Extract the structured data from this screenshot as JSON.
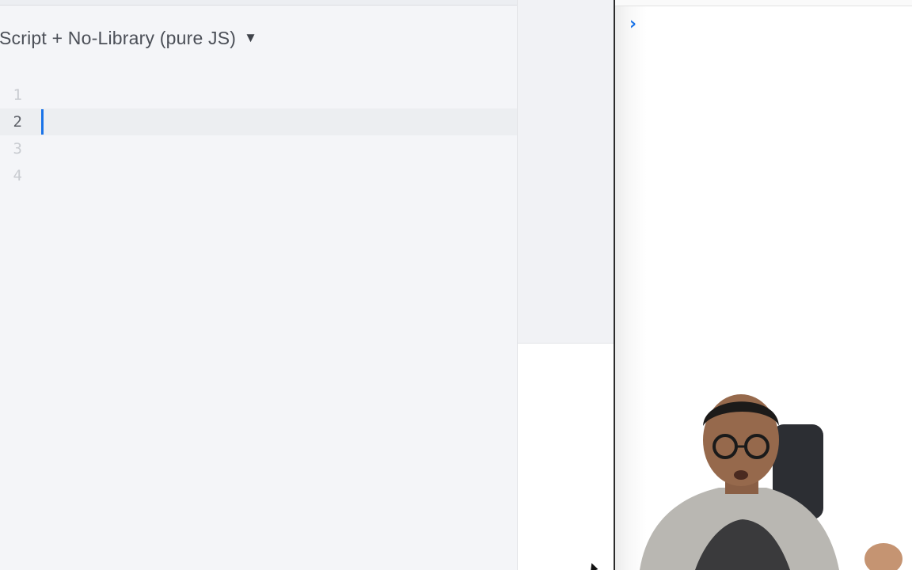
{
  "editor": {
    "language_label": "aScript + No-Library (pure JS)",
    "caret_symbol": "▼",
    "lines": [
      {
        "number": "1",
        "text": ""
      },
      {
        "number": "2",
        "text": ""
      },
      {
        "number": "3",
        "text": ""
      },
      {
        "number": "4",
        "text": ""
      }
    ],
    "active_line": 2
  },
  "console": {
    "prompt_symbol": "›"
  },
  "colors": {
    "accent": "#1a73e8",
    "editor_bg": "#f4f5f8",
    "divider": "#2b2b2b"
  },
  "icons": {
    "language_dropdown": "triangle-down-icon",
    "console_prompt": "chevron-right-icon",
    "mouse_pointer": "cursor-arrow-icon"
  }
}
